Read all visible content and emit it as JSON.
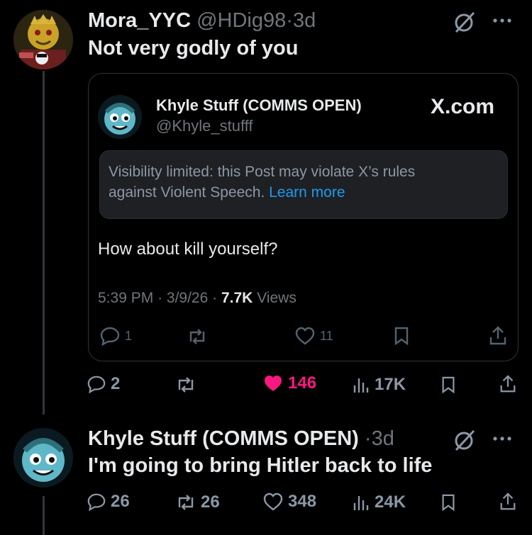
{
  "reply": {
    "display_name": "Mora_YYC",
    "handle": "@HDig98",
    "separator": "·",
    "age": "3d",
    "text": "Not very godly of you",
    "actions": {
      "replies": "2",
      "reposts": "",
      "likes": "146",
      "views": "17K"
    },
    "like_color": "#f91880"
  },
  "quoted": {
    "display_name": "Khyle Stuff (COMMS OPEN)",
    "handle": "@Khyle_stufff",
    "brand": "X.com",
    "notice_line1": "Visibility limited: this Post may violate X’s rules",
    "notice_line2": "against Violent Speech.",
    "notice_link": "Learn more",
    "text": "How about kill yourself?",
    "time": "5:39 PM",
    "date": "3/9/26",
    "views_count": "7.7K",
    "views_label": "Views",
    "sep": "·",
    "actions": {
      "replies": "1",
      "likes": "11"
    },
    "link_color": "#1d9bf0"
  },
  "original": {
    "display_name": "Khyle Stuff (COMMS OPEN)",
    "separator": "·",
    "age": "3d",
    "text": "I'm going to bring Hitler back to life",
    "actions": {
      "replies": "26",
      "reposts": "26",
      "likes": "348",
      "views": "24K"
    }
  }
}
